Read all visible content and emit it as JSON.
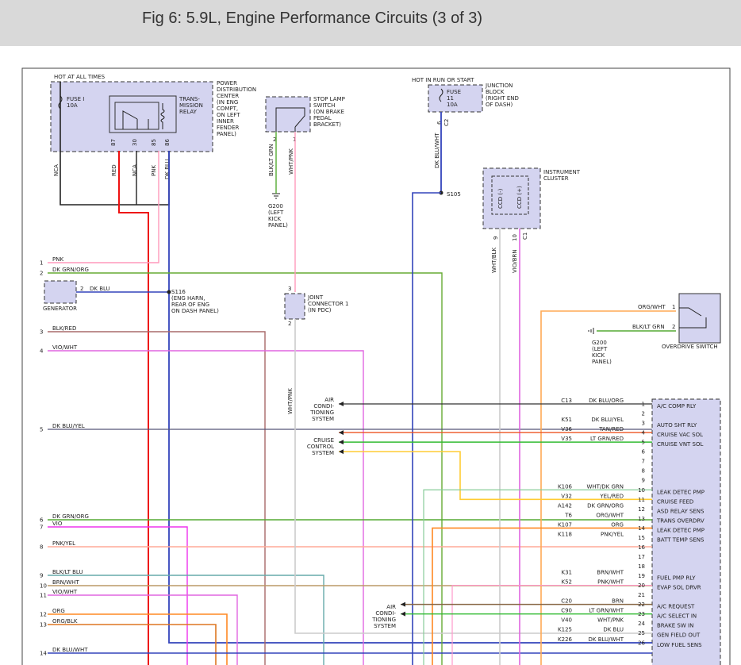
{
  "header": {
    "title": "Fig 6: 5.9L, Engine Performance Circuits (3 of 3)"
  },
  "components": {
    "hot_at_all_times": "HOT AT ALL TIMES",
    "fuse_i": [
      "FUSE I",
      "10A"
    ],
    "pdc": [
      "POWER",
      "DISTRIBUTION",
      "CENTER",
      "(IN ENG",
      "COMPT,",
      "ON LEFT",
      "INNER",
      "FENDER",
      "PANEL)"
    ],
    "relay": [
      "TRANS-",
      "MISSION",
      "RELAY"
    ],
    "relay_pins": [
      "87",
      "30",
      "85",
      "86"
    ],
    "pdc_wires": [
      "NCA",
      "RED",
      "NCA",
      "PNK",
      "DK BLU"
    ],
    "stop_lamp": [
      "STOP LAMP",
      "SWITCH",
      "(ON BRAKE",
      "PEDAL",
      "BRACKET)"
    ],
    "stop_pins": [
      "2",
      "1"
    ],
    "stop_wires": [
      "BLK/LT GRN",
      "WHT/PNK"
    ],
    "g200_left": [
      "G200",
      "(LEFT",
      "KICK",
      "PANEL)"
    ],
    "hot_in_run": "HOT IN RUN OR START",
    "fuse_11": [
      "FUSE",
      "11",
      "10A"
    ],
    "junction_block": [
      "JUNCTION",
      "BLOCK",
      "(RIGHT END",
      "OF DASH)"
    ],
    "jb_pins": [
      "6",
      "C2"
    ],
    "jb_wire": "DK BLU/WHT",
    "s105": "S105",
    "cluster": [
      "INSTRUMENT",
      "CLUSTER"
    ],
    "ccd": [
      "CCD (-)",
      "CCD (+)"
    ],
    "cluster_pins": [
      "9",
      "10",
      "C1"
    ],
    "cluster_wires": [
      "WHT/BLK",
      "VIO/BRN"
    ],
    "generator": "GENERATOR",
    "gen_pin": "2",
    "gen_wire": "DK BLU",
    "s116": [
      "S116",
      "(ENG HARN,",
      "REAR OF ENG",
      "ON DASH PANEL)"
    ],
    "joint_connector": [
      "JOINT",
      "CONNECTOR 1",
      "(IN PDC)"
    ],
    "jc_pins": [
      "3",
      "2"
    ],
    "jc_wire": "WHT/PNK",
    "overdrive": {
      "label": "OVERDRIVE SWITCH",
      "wires": [
        "ORG/WHT",
        "BLK/LT GRN"
      ],
      "pins": [
        "1",
        "2"
      ],
      "g200": [
        "G200",
        "(LEFT",
        "KICK",
        "PANEL)"
      ]
    },
    "air_cond_upper": [
      "AIR",
      "CONDI-",
      "TIONING",
      "SYSTEM"
    ],
    "cruise": [
      "CRUISE",
      "CONTROL",
      "SYSTEM"
    ],
    "air_cond_lower": [
      "AIR",
      "CONDI-",
      "TIONING",
      "SYSTEM"
    ]
  },
  "left_wires": [
    {
      "num": "1",
      "label": "PNK",
      "color": "#ff99bb"
    },
    {
      "num": "2",
      "label": "DK GRN/ORG",
      "color": "#66aa33"
    },
    {
      "num": "3",
      "label": "BLK/RED",
      "color": "#a86a6a"
    },
    {
      "num": "4",
      "label": "VIO/WHT",
      "color": "#e066e0"
    },
    {
      "num": "5",
      "label": "DK BLU/YEL",
      "color": "#555577"
    },
    {
      "num": "6",
      "label": "DK GRN/ORG",
      "color": "#55aa33"
    },
    {
      "num": "7",
      "label": "VIO",
      "color": "#ee33ee"
    },
    {
      "num": "8",
      "label": "PNK/YEL",
      "color": "#ffaa99"
    },
    {
      "num": "9",
      "label": "BLK/LT BLU",
      "color": "#66aaaa"
    },
    {
      "num": "10",
      "label": "BRN/WHT",
      "color": "#bb9966"
    },
    {
      "num": "11",
      "label": "VIO/WHT",
      "color": "#e066e0"
    },
    {
      "num": "12",
      "label": "ORG",
      "color": "#ff8822"
    },
    {
      "num": "13",
      "label": "ORG/BLK",
      "color": "#dd7722"
    },
    {
      "num": "14",
      "label": "DK BLU/WHT",
      "color": "#3344bb"
    }
  ],
  "pcm_rows": [
    {
      "pin": "1",
      "code": "C13",
      "wire": "DK BLU/ORG",
      "func": "A/C COMP RLY"
    },
    {
      "pin": "2",
      "code": "",
      "wire": "",
      "func": ""
    },
    {
      "pin": "3",
      "code": "K51",
      "wire": "DK BLU/YEL",
      "func": "AUTO SHT RLY"
    },
    {
      "pin": "4",
      "code": "V36",
      "wire": "TAN/RED",
      "func": "CRUISE VAC SOL"
    },
    {
      "pin": "5",
      "code": "V35",
      "wire": "LT GRN/RED",
      "func": "CRUISE VNT SOL"
    },
    {
      "pin": "6",
      "code": "",
      "wire": "",
      "func": ""
    },
    {
      "pin": "7",
      "code": "",
      "wire": "",
      "func": ""
    },
    {
      "pin": "8",
      "code": "",
      "wire": "",
      "func": ""
    },
    {
      "pin": "9",
      "code": "",
      "wire": "",
      "func": ""
    },
    {
      "pin": "10",
      "code": "K106",
      "wire": "WHT/DK GRN",
      "func": "LEAK DETEC PMP"
    },
    {
      "pin": "11",
      "code": "V32",
      "wire": "YEL/RED",
      "func": "CRUISE FEED"
    },
    {
      "pin": "12",
      "code": "A142",
      "wire": "DK GRN/ORG",
      "func": "ASD RELAY SENS"
    },
    {
      "pin": "13",
      "code": "T6",
      "wire": "ORG/WHT",
      "func": "TRANS OVERDRV"
    },
    {
      "pin": "14",
      "code": "K107",
      "wire": "ORG",
      "func": "LEAK DETEC PMP"
    },
    {
      "pin": "15",
      "code": "K118",
      "wire": "PNK/YEL",
      "func": "BATT TEMP SENS"
    },
    {
      "pin": "16",
      "code": "",
      "wire": "",
      "func": ""
    },
    {
      "pin": "17",
      "code": "",
      "wire": "",
      "func": ""
    },
    {
      "pin": "18",
      "code": "",
      "wire": "",
      "func": ""
    },
    {
      "pin": "19",
      "code": "K31",
      "wire": "BRN/WHT",
      "func": "FUEL PMP RLY"
    },
    {
      "pin": "20",
      "code": "K52",
      "wire": "PNK/WHT",
      "func": "EVAP SOL DRVR"
    },
    {
      "pin": "21",
      "code": "",
      "wire": "",
      "func": ""
    },
    {
      "pin": "22",
      "code": "C20",
      "wire": "BRN",
      "func": "A/C REQUEST"
    },
    {
      "pin": "23",
      "code": "C90",
      "wire": "LT GRN/WHT",
      "func": "A/C SELECT IN"
    },
    {
      "pin": "24",
      "code": "V40",
      "wire": "WHT/PNK",
      "func": "BRAKE SW IN"
    },
    {
      "pin": "25",
      "code": "K125",
      "wire": "DK BLU",
      "func": "GEN FIELD OUT"
    },
    {
      "pin": "26",
      "code": "K226",
      "wire": "DK BLU/WHT",
      "func": "LOW FUEL SENS"
    }
  ]
}
